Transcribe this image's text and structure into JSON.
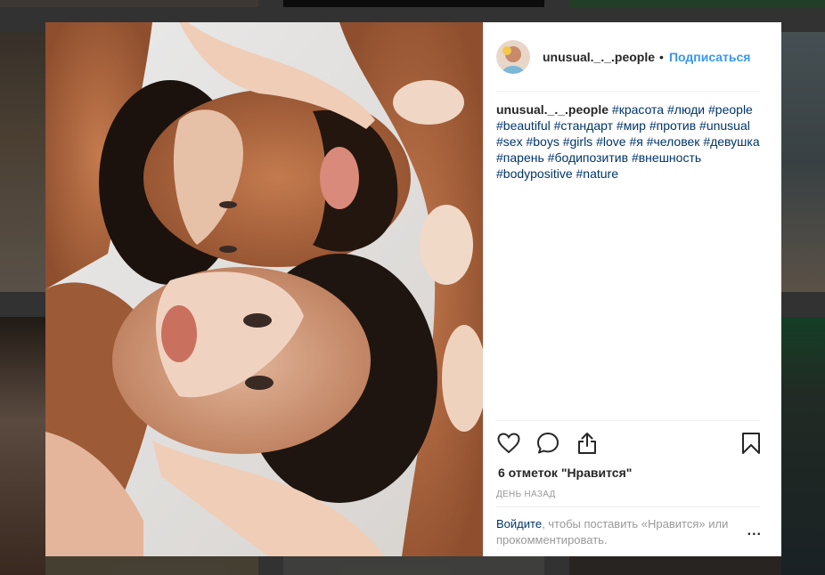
{
  "post": {
    "username": "unusual._._.people",
    "separator": "•",
    "follow_label": "Подписаться",
    "caption_user": "unusual._._.people",
    "hashtags": [
      "#красота",
      "#люди",
      "#people",
      "#beautiful",
      "#стандарт",
      "#мир",
      "#против",
      "#unusual",
      "#sex",
      "#boys",
      "#girls",
      "#love",
      "#я",
      "#человек",
      "#девушка",
      "#парень",
      "#бодипозитив",
      "#внешность",
      "#bodypositive",
      "#nature"
    ],
    "likes_text": "6 отметок \"Нравится\"",
    "timestamp": "ДЕНЬ НАЗАД",
    "login_link": "Войдите",
    "login_rest": ", чтобы поставить «Нравится» или прокомментировать.",
    "more_label": "..."
  },
  "icons": {
    "like": "heart-icon",
    "comment": "comment-icon",
    "share": "share-icon",
    "save": "bookmark-icon"
  },
  "colors": {
    "accent": "#3897f0",
    "hashtag": "#003569",
    "text": "#262626",
    "muted": "#999999"
  }
}
